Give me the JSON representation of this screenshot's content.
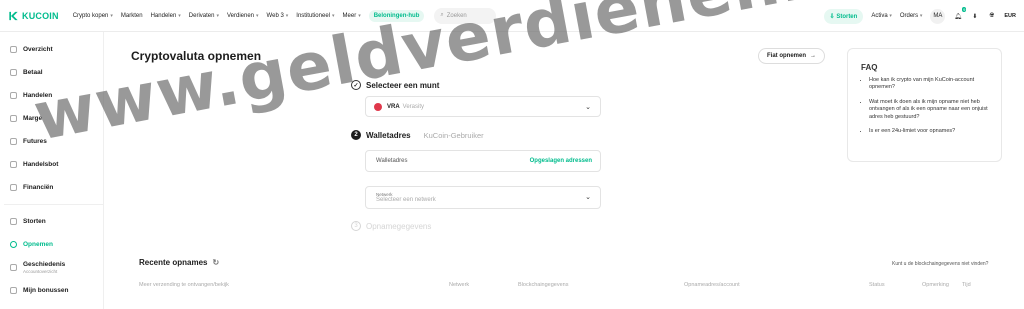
{
  "brand": {
    "name": "KUCOIN",
    "accent": "#01bc8d"
  },
  "nav": [
    {
      "label": "Crypto kopen",
      "chevron": true
    },
    {
      "label": "Markten",
      "chevron": false
    },
    {
      "label": "Handelen",
      "chevron": true
    },
    {
      "label": "Derivaten",
      "chevron": true
    },
    {
      "label": "Verdienen",
      "chevron": true
    },
    {
      "label": "Web 3",
      "chevron": true
    },
    {
      "label": "Institutioneel",
      "chevron": true
    },
    {
      "label": "Meer",
      "chevron": true
    }
  ],
  "rewards_hub": "Beloningen-hub",
  "search": {
    "placeholder": "Zoeken"
  },
  "right": {
    "deposit": "Storten",
    "assets": "Activa",
    "orders": "Orders",
    "avatar": "MA",
    "notif_count": "9",
    "currency": "EUR"
  },
  "sidebar": {
    "group1": [
      "Overzicht",
      "Betaal",
      "Handelen",
      "Marge",
      "Futures",
      "Handelsbot",
      "Financiën"
    ],
    "group2": [
      "Storten",
      "Opnemen"
    ],
    "history": {
      "label": "Geschiedenis",
      "sub": "Accountoverzicht"
    },
    "bonus": "Mijn bonussen"
  },
  "page": {
    "title": "Cryptovaluta opnemen",
    "fiat_button": "Fiat opnemen",
    "step1": "Selecteer een munt",
    "coin_symbol": "VRA",
    "coin_name": "Verasity",
    "step2_num": "2",
    "step2": "Walletadres",
    "step2_alt": "KuCoin-Gebruiker",
    "wallet_placeholder": "Walletadres",
    "saved_addresses": "Opgeslagen adressen",
    "network_label": "Netwerk",
    "network_placeholder": "Selecteer een netwerk",
    "step3_num": "3",
    "step3": "Opnamegegevens"
  },
  "faq": {
    "title": "FAQ",
    "items": [
      "Hoe kan ik crypto van mijn KuCoin-account opnemen?",
      "Wat moet ik doen als ik mijn opname niet heb ontvangen of als ik een opname naar een onjuist adres heb gestuurd?",
      "Is er een 24u-limiet voor opnames?"
    ]
  },
  "recent": {
    "title": "Recente opnames",
    "link": "Kunt u de blockchaingegevens niet vinden?",
    "columns": [
      "Munt",
      "Netwerk",
      "Blockchaingegevens",
      "Opnameadres/account",
      "Status",
      "Opmerking",
      "Tijd"
    ],
    "filter_hint": "Meer verzending te ontvangen/bekijk"
  },
  "watermark": "www.geldverdienenmetpassie.nl"
}
